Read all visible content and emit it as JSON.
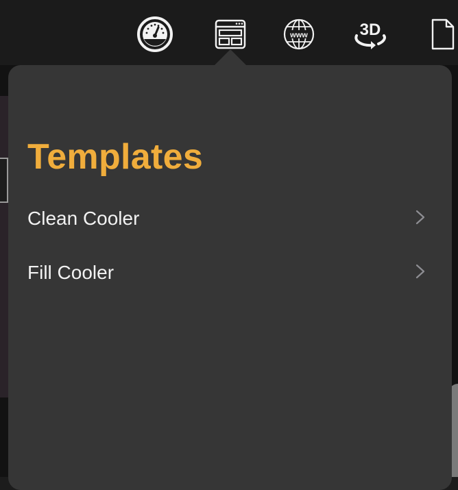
{
  "toolbar": {
    "buttons": [
      {
        "name": "dashboard",
        "icon": "gauge-icon"
      },
      {
        "name": "templates",
        "icon": "layout-template-icon"
      },
      {
        "name": "web",
        "icon": "globe-www-icon",
        "text": "www"
      },
      {
        "name": "3d",
        "icon": "rotate-3d-icon",
        "text": "3D"
      },
      {
        "name": "document",
        "icon": "document-icon"
      }
    ]
  },
  "popover": {
    "title": "Templates",
    "items": [
      {
        "label": "Clean Cooler"
      },
      {
        "label": "Fill Cooler"
      }
    ]
  },
  "colors": {
    "toolbar_bg": "#1b1b1b",
    "popover_bg": "#363636",
    "title_accent": "#f0ad3c",
    "text": "#f2f2f2",
    "chevron": "#8e8e93"
  }
}
